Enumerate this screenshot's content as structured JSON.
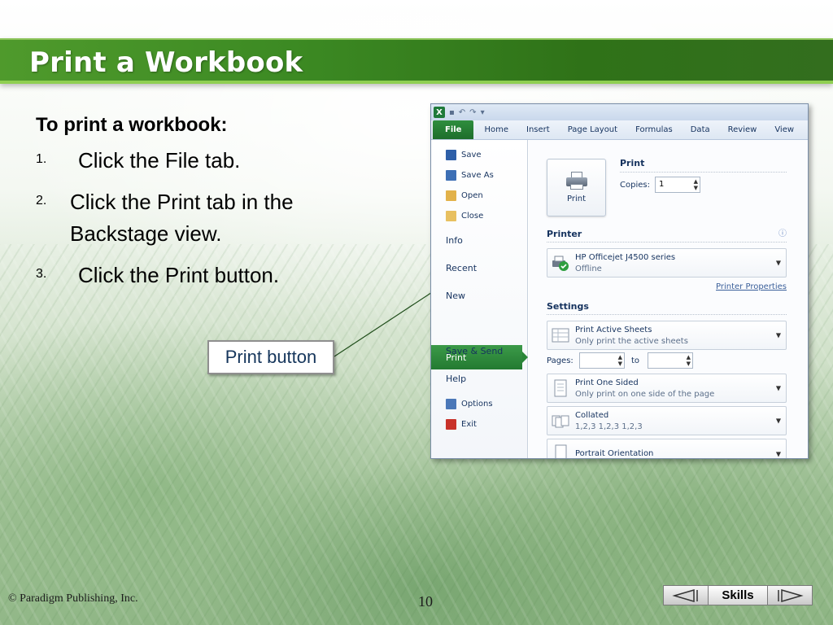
{
  "slide": {
    "title": "Print a Workbook",
    "heading": "To print a workbook:",
    "steps": [
      {
        "num": "1.",
        "text": "Click the File tab."
      },
      {
        "num": "2.",
        "text": "Click the Print tab in the Backstage view."
      },
      {
        "num": "3.",
        "text": "Click the Print button."
      }
    ],
    "callout": "Print button"
  },
  "excel": {
    "logo": "X",
    "ribbon_tabs": [
      "File",
      "Home",
      "Insert",
      "Page Layout",
      "Formulas",
      "Data",
      "Review",
      "View"
    ],
    "nav": {
      "commands": [
        {
          "label": "Save",
          "icon": "save-icon",
          "color": "#2e5fa8"
        },
        {
          "label": "Save As",
          "icon": "save-as-icon",
          "color": "#3d6fb5"
        },
        {
          "label": "Open",
          "icon": "folder-open-icon",
          "color": "#e2b24a"
        },
        {
          "label": "Close",
          "icon": "folder-close-icon",
          "color": "#e8c060"
        }
      ],
      "tabs": [
        "Info",
        "Recent",
        "New",
        "Print",
        "Save & Send",
        "Help"
      ],
      "bottom_commands": [
        {
          "label": "Options",
          "icon": "options-icon",
          "color": "#4b78b8"
        },
        {
          "label": "Exit",
          "icon": "exit-icon",
          "color": "#c8322a"
        }
      ]
    },
    "print": {
      "button_label": "Print",
      "section_title": "Print",
      "copies_label": "Copies:",
      "copies_value": "1",
      "printer_title": "Printer",
      "printer_name": "HP Officejet J4500 series",
      "printer_status": "Offline",
      "printer_properties": "Printer Properties",
      "settings_title": "Settings",
      "active_sheets_main": "Print Active Sheets",
      "active_sheets_sub": "Only print the active sheets",
      "pages_label": "Pages:",
      "to_label": "to",
      "sided_main": "Print One Sided",
      "sided_sub": "Only print on one side of the page",
      "collated_main": "Collated",
      "collated_sub": "1,2,3   1,2,3   1,2,3",
      "orientation_main": "Portrait Orientation"
    }
  },
  "footer": {
    "copyright": "© Paradigm Publishing, Inc.",
    "page_number": "10",
    "skills_label": "Skills"
  },
  "colors": {
    "title_bar": "#3c8a23",
    "excel_file_tab": "#2f8e3e",
    "callout_text": "#16365c"
  }
}
